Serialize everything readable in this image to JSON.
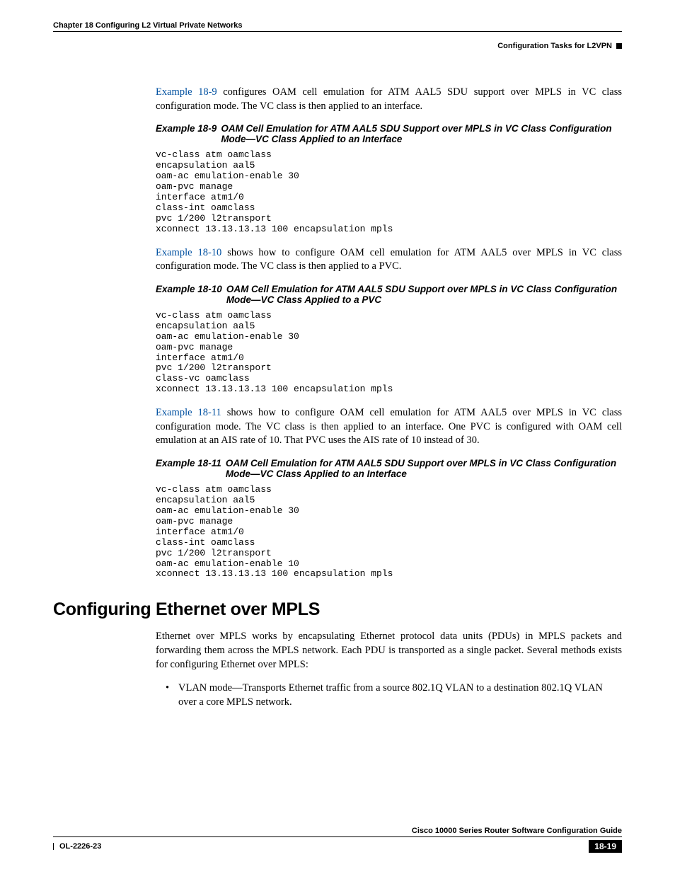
{
  "header": {
    "chapter": "Chapter 18      Configuring L2 Virtual Private Networks",
    "section": "Configuration Tasks for L2VPN"
  },
  "intro1": {
    "link": "Example 18-9",
    "rest": " configures OAM cell emulation for ATM AAL5 SDU support over MPLS in VC class configuration mode. The VC class is then applied to an interface."
  },
  "example1": {
    "label": "Example 18-9",
    "caption": "OAM Cell Emulation for ATM AAL5 SDU Support over MPLS in VC Class Configuration Mode—VC Class Applied to an Interface",
    "code": "vc-class atm oamclass\nencapsulation aal5\noam-ac emulation-enable 30\noam-pvc manage\ninterface atm1/0\nclass-int oamclass\npvc 1/200 l2transport\nxconnect 13.13.13.13 100 encapsulation mpls"
  },
  "intro2": {
    "link": "Example 18-10",
    "rest": " shows how to configure OAM cell emulation for ATM AAL5 over MPLS in VC class configuration mode. The VC class is then applied to a PVC."
  },
  "example2": {
    "label": "Example 18-10",
    "caption": "OAM Cell Emulation for ATM AAL5 SDU Support over MPLS in VC Class Configuration Mode—VC Class Applied to a PVC",
    "code": "vc-class atm oamclass\nencapsulation aal5\noam-ac emulation-enable 30\noam-pvc manage\ninterface atm1/0\npvc 1/200 l2transport\nclass-vc oamclass\nxconnect 13.13.13.13 100 encapsulation mpls"
  },
  "intro3": {
    "link": "Example 18-11",
    "rest": " shows how to configure OAM cell emulation for ATM AAL5 over MPLS in VC class configuration mode. The VC class is then applied to an interface. One PVC is configured with OAM cell emulation at an AIS rate of 10. That PVC uses the AIS rate of 10 instead of 30."
  },
  "example3": {
    "label": "Example 18-11",
    "caption": "OAM Cell Emulation for ATM AAL5 SDU Support over MPLS in VC Class Configuration Mode—VC Class Applied to an Interface",
    "code": "vc-class atm oamclass\nencapsulation aal5\noam-ac emulation-enable 30\noam-pvc manage\ninterface atm1/0\nclass-int oamclass\npvc 1/200 l2transport\noam-ac emulation-enable 10\nxconnect 13.13.13.13 100 encapsulation mpls"
  },
  "section2": {
    "title": "Configuring Ethernet over MPLS",
    "body": "Ethernet over MPLS works by encapsulating Ethernet protocol data units (PDUs) in MPLS packets and forwarding them across the MPLS network. Each PDU is transported as a single packet. Several methods exists for configuring Ethernet over MPLS:",
    "bullet1": "VLAN mode—Transports Ethernet traffic from a source 802.1Q VLAN to a destination 802.1Q VLAN over a core MPLS network."
  },
  "footer": {
    "title": "Cisco 10000 Series Router Software Configuration Guide",
    "left": "OL-2226-23",
    "right": "18-19"
  }
}
